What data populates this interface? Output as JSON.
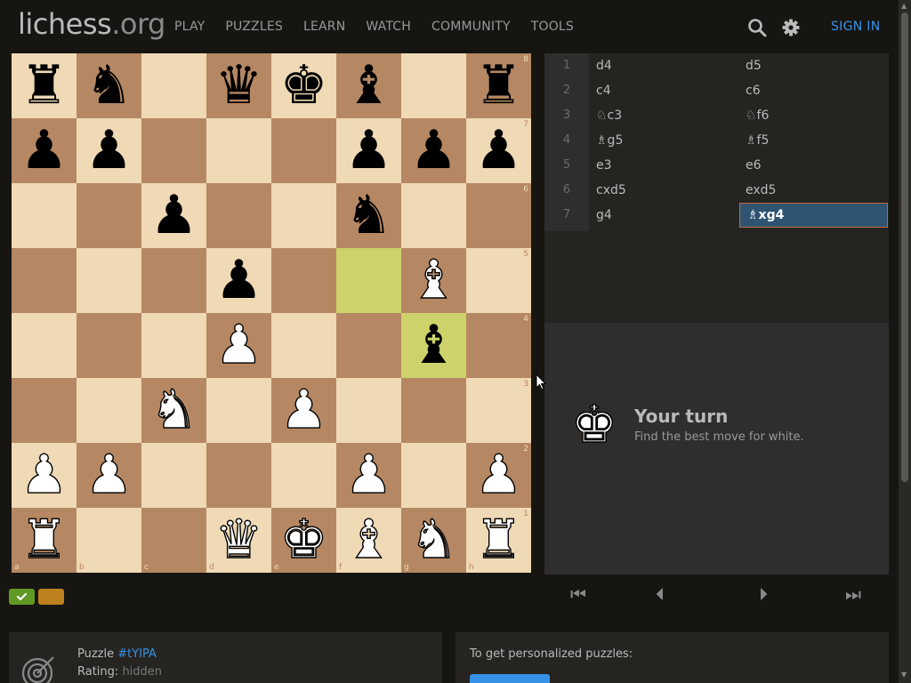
{
  "header": {
    "logo_main": "lichess",
    "logo_tld": ".org",
    "nav": [
      "PLAY",
      "PUZZLES",
      "LEARN",
      "WATCH",
      "COMMUNITY",
      "TOOLS"
    ],
    "sign_in": "SIGN IN"
  },
  "board": {
    "ranks": [
      "8",
      "7",
      "6",
      "5",
      "4",
      "3",
      "2",
      "1"
    ],
    "files": [
      "a",
      "b",
      "c",
      "d",
      "e",
      "f",
      "g",
      "h"
    ],
    "rows": [
      [
        "bR",
        "bN",
        "",
        "bQ",
        "bK",
        "bB",
        "",
        "bR"
      ],
      [
        "bP",
        "bP",
        "",
        "",
        "",
        "bP",
        "bP",
        "bP"
      ],
      [
        "",
        "",
        "bP",
        "",
        "",
        "bN",
        "",
        ""
      ],
      [
        "",
        "",
        "",
        "bP",
        "",
        "",
        "wB",
        ""
      ],
      [
        "",
        "",
        "",
        "wP",
        "",
        "",
        "bB",
        ""
      ],
      [
        "",
        "",
        "wN",
        "",
        "wP",
        "",
        "",
        ""
      ],
      [
        "wP",
        "wP",
        "",
        "",
        "",
        "wP",
        "",
        "wP"
      ],
      [
        "wR",
        "",
        "",
        "wQ",
        "wK",
        "wB",
        "wN",
        "wR"
      ]
    ],
    "highlight_squares": [
      "f5",
      "g4"
    ],
    "colors": {
      "light": "#f0d9b5",
      "dark": "#b58863",
      "highlight_light": "#cdd26a",
      "highlight_dark": "#aaa23a"
    }
  },
  "moves": [
    {
      "num": "1",
      "white": "d4",
      "black": "d5"
    },
    {
      "num": "2",
      "white": "c4",
      "black": "c6"
    },
    {
      "num": "3",
      "white": "♘c3",
      "black": "♘f6"
    },
    {
      "num": "4",
      "white": "♗g5",
      "black": "♗f5"
    },
    {
      "num": "5",
      "white": "e3",
      "black": "e6"
    },
    {
      "num": "6",
      "white": "cxd5",
      "black": "exd5"
    },
    {
      "num": "7",
      "white": "g4",
      "black": "♗xg4"
    }
  ],
  "turn": {
    "title": "Your turn",
    "subtitle": "Find the best move for white."
  },
  "controls": {
    "nav_icons": [
      "first-icon",
      "prev-icon",
      "next-icon",
      "last-icon"
    ],
    "nav_glyphs": [
      "⏮",
      "⏴",
      "⏵",
      "⏭"
    ]
  },
  "puzzle": {
    "label": "Puzzle",
    "id": "#tYIPA",
    "rating_label": "Rating:",
    "rating_value": "hidden"
  },
  "personalized": {
    "text": "To get personalized puzzles:"
  },
  "accent": "#3692e7"
}
